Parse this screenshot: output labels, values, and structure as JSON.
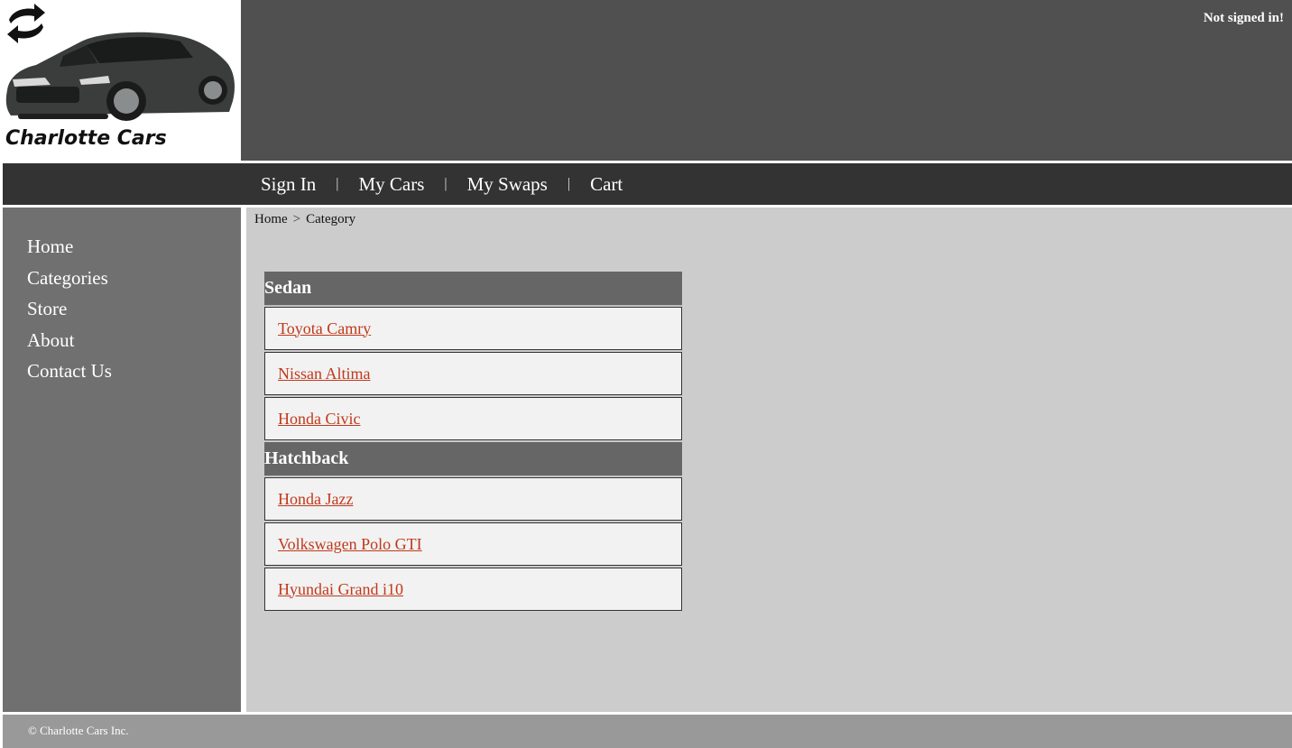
{
  "header": {
    "brand_name": "Charlotte Cars",
    "signin_status": "Not signed in!"
  },
  "nav": {
    "items": [
      {
        "label": "Sign In"
      },
      {
        "label": "My Cars"
      },
      {
        "label": "My Swaps"
      },
      {
        "label": "Cart"
      }
    ],
    "separator": "|"
  },
  "sidebar": {
    "items": [
      {
        "label": "Home"
      },
      {
        "label": "Categories"
      },
      {
        "label": "Store"
      },
      {
        "label": "About"
      },
      {
        "label": "Contact Us"
      }
    ]
  },
  "breadcrumb": {
    "items": [
      "Home",
      "Category"
    ],
    "separator": ">"
  },
  "categories": [
    {
      "name": "Sedan",
      "items": [
        "Toyota Camry",
        "Nissan Altima",
        "Honda Civic"
      ]
    },
    {
      "name": "Hatchback",
      "items": [
        "Honda Jazz",
        "Volkswagen Polo GTI",
        "Hyundai Grand i10"
      ]
    }
  ],
  "footer": {
    "copyright": "© Charlotte Cars Inc."
  },
  "colors": {
    "header_bg": "#505050",
    "nav_bg": "#333333",
    "sidebar_bg": "#707070",
    "main_bg": "#cccccc",
    "category_header_bg": "#666666",
    "link_color": "#c0391b",
    "footer_bg": "#999999"
  },
  "icons": {
    "logo": "swap-arrows-car-logo"
  }
}
